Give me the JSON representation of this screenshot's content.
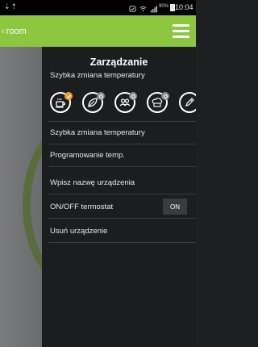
{
  "status_bar": {
    "left_icon": "usb-debug-icon",
    "battery_percent": "90%",
    "time": "10:04"
  },
  "app_bar": {
    "back_label": "room",
    "menu_icon": "hamburger-menu-icon",
    "color": "#8dc63f"
  },
  "drawer": {
    "title": "Zarządzanie",
    "quick_change_label": "Szybka zmiana temperatury",
    "mode_icons": [
      {
        "name": "hot-cup-icon",
        "badge": "checkmark",
        "active": true
      },
      {
        "name": "leaf-icon",
        "badge": "gear",
        "active": false
      },
      {
        "name": "people-icon",
        "badge": "gear",
        "active": false
      },
      {
        "name": "chef-hat-icon",
        "badge": "gear",
        "active": false
      },
      {
        "name": "pencil-icon",
        "badge": "none",
        "active": false
      }
    ],
    "items": [
      {
        "label": "Szybka zmiana temperatury"
      },
      {
        "label": "Programowanie temp."
      },
      {
        "label": "Wpisz nazwę urządzenia"
      },
      {
        "label": "ON/OFF termostat",
        "toggle": "ON"
      },
      {
        "label": "Usuń urządzenie"
      }
    ]
  },
  "colors": {
    "accent": "#8dc63f",
    "badge_active": "#f39c33",
    "badge_inactive": "#8c8c8c",
    "drawer_bg": "#1c1d1e"
  }
}
